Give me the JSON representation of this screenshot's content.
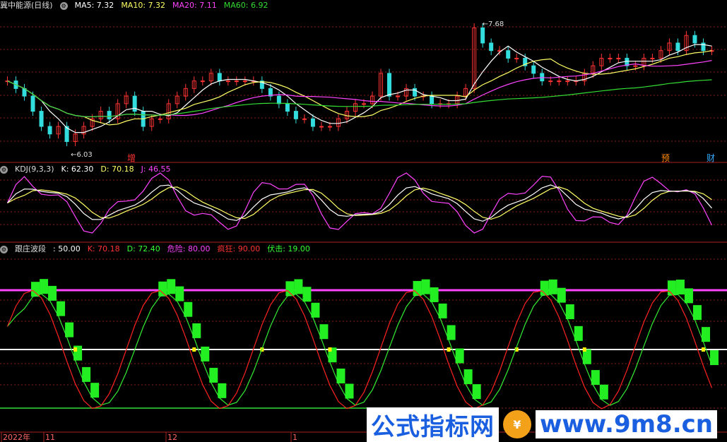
{
  "panel1": {
    "title": "冀中能源(日线)",
    "labels": [
      {
        "text": "MA5: 7.32",
        "color": "#ffffff"
      },
      {
        "text": "MA10: 7.32",
        "color": "#ffff66"
      },
      {
        "text": "MA20: 7.11",
        "color": "#ff44ff"
      },
      {
        "text": "MA60: 6.92",
        "color": "#33dd33"
      }
    ],
    "high_label": "7.68",
    "low_label": "6.03",
    "markers": [
      {
        "text": "增",
        "color": "#ff3333"
      },
      {
        "text": "预",
        "color": "#ff8800"
      },
      {
        "text": "财",
        "color": "#33aaff"
      }
    ]
  },
  "panel2": {
    "labels": [
      {
        "text": "KDJ(9,3,3)",
        "color": "#dddddd"
      },
      {
        "text": "K: 62.30",
        "color": "#ffffff"
      },
      {
        "text": "D: 70.18",
        "color": "#ffff66"
      },
      {
        "text": "J: 46.55",
        "color": "#ff44ff"
      }
    ]
  },
  "panel3": {
    "labels": [
      {
        "text": "跟庄波段",
        "color": "#dddddd"
      },
      {
        "text": ": 50.00",
        "color": "#ffffff"
      },
      {
        "text": "K: 70.18",
        "color": "#ff3333"
      },
      {
        "text": "D: 72.40",
        "color": "#33ff33"
      },
      {
        "text": "危险: 80.00",
        "color": "#ff44ff"
      },
      {
        "text": "疯狂: 90.00",
        "color": "#ff3333"
      },
      {
        "text": "伏击: 19.00",
        "color": "#33ff33"
      }
    ]
  },
  "xaxis": [
    "2022年",
    "11",
    "12",
    "1"
  ],
  "watermark": {
    "left": "公式指标网",
    "right": "www.9m8.cn"
  },
  "chart_data": [
    {
      "type": "candlestick",
      "title": "冀中能源(日线)",
      "annotations": {
        "high": 7.68,
        "low": 6.03
      },
      "close": [
        6.9,
        6.8,
        6.7,
        6.5,
        6.3,
        6.2,
        6.3,
        6.1,
        6.2,
        6.3,
        6.4,
        6.5,
        6.4,
        6.6,
        6.7,
        6.5,
        6.3,
        6.4,
        6.4,
        6.6,
        6.7,
        6.8,
        6.9,
        6.9,
        7.0,
        6.9,
        6.9,
        6.9,
        6.9,
        6.9,
        6.8,
        6.7,
        6.6,
        6.5,
        6.4,
        6.4,
        6.3,
        6.3,
        6.3,
        6.4,
        6.5,
        6.6,
        6.6,
        6.7,
        7.0,
        6.7,
        6.7,
        6.8,
        6.7,
        6.7,
        6.6,
        6.6,
        6.6,
        6.7,
        6.8,
        7.6,
        7.4,
        7.3,
        7.3,
        7.2,
        7.2,
        7.1,
        7.0,
        6.9,
        6.9,
        6.9,
        6.9,
        6.9,
        7.0,
        7.1,
        7.2,
        7.2,
        7.2,
        7.1,
        7.1,
        7.2,
        7.2,
        7.3,
        7.4,
        7.3,
        7.5,
        7.4,
        7.3,
        7.3
      ],
      "series_labels": [
        "MA5",
        "MA10",
        "MA20",
        "MA60"
      ],
      "series_last": [
        7.32,
        7.32,
        7.11,
        6.92
      ]
    },
    {
      "type": "line",
      "title": "KDJ(9,3,3)",
      "series": [
        {
          "name": "K",
          "last": 62.3
        },
        {
          "name": "D",
          "last": 70.18
        },
        {
          "name": "J",
          "last": 46.55
        }
      ]
    },
    {
      "type": "line",
      "title": "跟庄波段",
      "series": [
        {
          "name": "K",
          "last": 70.18
        },
        {
          "name": "D",
          "last": 72.4
        }
      ],
      "levels": {
        "mid": 50.0,
        "danger": 80.0,
        "crazy": 90.0,
        "ambush": 19.0
      }
    }
  ],
  "colors": {
    "grid": "#8b1a1a",
    "up": "#ff3333",
    "down": "#33dddd",
    "ma5": "#ffffff",
    "ma10": "#ffff66",
    "ma20": "#ff44ff",
    "ma60": "#33dd33"
  }
}
